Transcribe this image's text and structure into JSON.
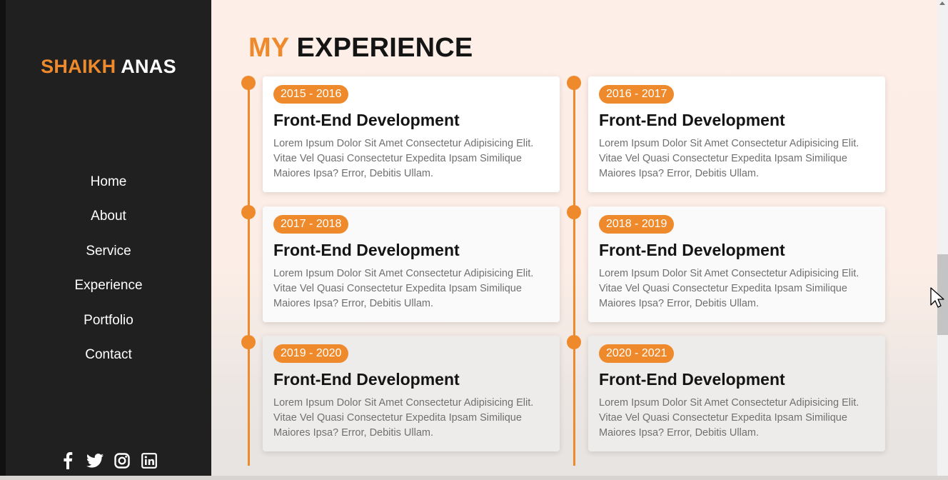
{
  "brand": {
    "first": "SHAIKH",
    "last": "ANAS",
    "accent_color": "#ee8a2c"
  },
  "nav": {
    "items": [
      {
        "label": "Home"
      },
      {
        "label": "About"
      },
      {
        "label": "Service"
      },
      {
        "label": "Experience"
      },
      {
        "label": "Portfolio"
      },
      {
        "label": "Contact"
      }
    ]
  },
  "social": [
    "facebook-icon",
    "twitter-icon",
    "instagram-icon",
    "linkedin-icon"
  ],
  "heading": {
    "accent": "MY",
    "rest": "EXPERIENCE"
  },
  "experience": [
    {
      "years": "2015 - 2016",
      "title": "Front-End Development",
      "desc": "Lorem Ipsum Dolor Sit Amet Consectetur Adipisicing Elit. Vitae Vel Quasi Consectetur Expedita Ipsam Similique Maiores Ipsa? Error, Debitis Ullam."
    },
    {
      "years": "2016 - 2017",
      "title": "Front-End Development",
      "desc": "Lorem Ipsum Dolor Sit Amet Consectetur Adipisicing Elit. Vitae Vel Quasi Consectetur Expedita Ipsam Similique Maiores Ipsa? Error, Debitis Ullam."
    },
    {
      "years": "2017 - 2018",
      "title": "Front-End Development",
      "desc": "Lorem Ipsum Dolor Sit Amet Consectetur Adipisicing Elit. Vitae Vel Quasi Consectetur Expedita Ipsam Similique Maiores Ipsa? Error, Debitis Ullam."
    },
    {
      "years": "2018 - 2019",
      "title": "Front-End Development",
      "desc": "Lorem Ipsum Dolor Sit Amet Consectetur Adipisicing Elit. Vitae Vel Quasi Consectetur Expedita Ipsam Similique Maiores Ipsa? Error, Debitis Ullam."
    },
    {
      "years": "2019 - 2020",
      "title": "Front-End Development",
      "desc": "Lorem Ipsum Dolor Sit Amet Consectetur Adipisicing Elit. Vitae Vel Quasi Consectetur Expedita Ipsam Similique Maiores Ipsa? Error, Debitis Ullam."
    },
    {
      "years": "2020 - 2021",
      "title": "Front-End Development",
      "desc": "Lorem Ipsum Dolor Sit Amet Consectetur Adipisicing Elit. Vitae Vel Quasi Consectetur Expedita Ipsam Similique Maiores Ipsa? Error, Debitis Ullam."
    }
  ]
}
